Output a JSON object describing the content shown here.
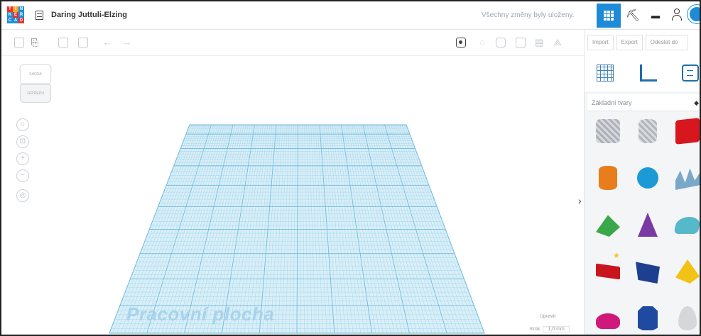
{
  "topbar": {
    "logo_letters": [
      "T",
      "I",
      "N",
      "K",
      "E",
      "R",
      "C",
      "A",
      "D"
    ],
    "title": "Daring Juttuli-Elzing",
    "saved_status": "Všechny změny byly uloženy.",
    "view_grid_icon": "grid-view-icon",
    "pick_icon": "pickaxe-icon",
    "blocks_icon": "bricks-icon",
    "user_icon": "add-user-icon",
    "accent_color": "#1d8bd8"
  },
  "toolbar": {
    "icons": [
      "copy-icon",
      "paste-icon",
      "duplicate-icon",
      "delete-icon",
      "undo-icon",
      "redo-icon"
    ],
    "right_icons": [
      "visibility-icon",
      "light-icon",
      "shape-icon",
      "group-icon",
      "align-icon",
      "mirror-icon"
    ]
  },
  "right_panel": {
    "tabs": [
      "Import",
      "Export",
      "Odeslat do"
    ],
    "tools": [
      "workplane-icon",
      "ruler-icon",
      "notes-icon"
    ],
    "shapes_category": "Základní tvary",
    "shapes": [
      {
        "name": "Box (striped)",
        "color": "#b9bcc2"
      },
      {
        "name": "Cylinder (striped)",
        "color": "#c5c8cc"
      },
      {
        "name": "Box",
        "color": "#d7161e"
      },
      {
        "name": "Cylinder",
        "color": "#e87d1c"
      },
      {
        "name": "Sphere",
        "color": "#1b9ad6"
      },
      {
        "name": "Scribble",
        "color": "#7ba8c9"
      },
      {
        "name": "Roof",
        "color": "#3aa84a"
      },
      {
        "name": "Cone",
        "color": "#7b3aa3"
      },
      {
        "name": "Round Roof",
        "color": "#55b9c9"
      },
      {
        "name": "Text",
        "color": "#c9151e"
      },
      {
        "name": "Wedge",
        "color": "#1e3f8f"
      },
      {
        "name": "Pyramid",
        "color": "#f2c217"
      },
      {
        "name": "Hemisphere",
        "color": "#d0187c"
      },
      {
        "name": "Polygon",
        "color": "#1f4aa0"
      },
      {
        "name": "Paraboloid",
        "color": "#d5d7da"
      }
    ]
  },
  "workplane": {
    "label": "Pracovní plocha",
    "edit_grid": "Upravit",
    "snap_label": "Krok",
    "snap_value": "1,0 mm",
    "grid_color": "#8ecde8",
    "viewcube_top": "SHORA",
    "viewcube_front": "ZEPŘEDU"
  }
}
